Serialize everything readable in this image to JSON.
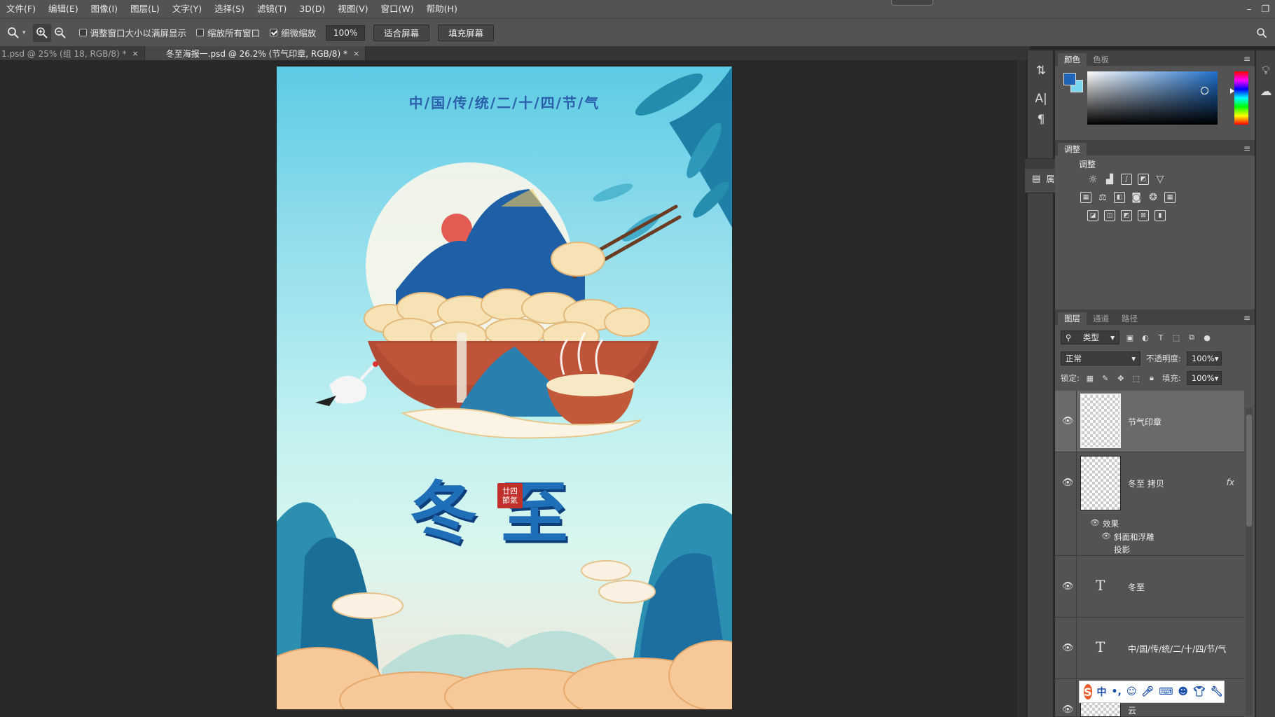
{
  "menubar": {
    "items": [
      "文件(F)",
      "编辑(E)",
      "图像(I)",
      "图层(L)",
      "文字(Y)",
      "选择(S)",
      "滤镜(T)",
      "3D(D)",
      "视图(V)",
      "窗口(W)",
      "帮助(H)"
    ]
  },
  "options": {
    "resize_windows": "调整窗口大小以满屏显示",
    "zoom_all_windows": "缩放所有窗口",
    "scrubby_zoom": "细微缩放",
    "zoom_value": "100%",
    "fit_screen": "适合屏幕",
    "fill_screen": "填充屏幕"
  },
  "tabs": [
    {
      "label": "1.psd @ 25% (组 18, RGB/8) *",
      "close": "×"
    },
    {
      "label": "冬至海报一.psd @ 26.2% (节气印章, RGB/8) *",
      "close": "×"
    }
  ],
  "poster": {
    "title": "中/国/传/统/二/十/四/节/气",
    "heading": "冬至",
    "seal": "廿四節氣"
  },
  "props_popup": {
    "label": "属性"
  },
  "color_panel": {
    "tabs": [
      "颜色",
      "色板"
    ],
    "fg_color": "#1e64b8",
    "bg_color": "#7ad7f0"
  },
  "adjust_panel": {
    "tab": "调整",
    "title": "调整"
  },
  "layers_panel": {
    "tabs": [
      "图层",
      "通道",
      "路径"
    ],
    "filter_type": "类型",
    "blend_mode": "正常",
    "opacity_label": "不透明度:",
    "opacity_value": "100%",
    "lock_label": "锁定:",
    "fill_label": "填充:",
    "fill_value": "100%",
    "layers": [
      {
        "name": "节气印章"
      },
      {
        "name": "冬至 拷贝",
        "fx": "fx"
      },
      {
        "name": "冬至"
      },
      {
        "name": "中/国/传/统/二/十/四/节/气"
      },
      {
        "name": "云"
      }
    ],
    "effects": {
      "label": "效果",
      "bevel": "斜面和浮雕",
      "shadow": "投影"
    }
  },
  "ime": {
    "mode": "中"
  }
}
